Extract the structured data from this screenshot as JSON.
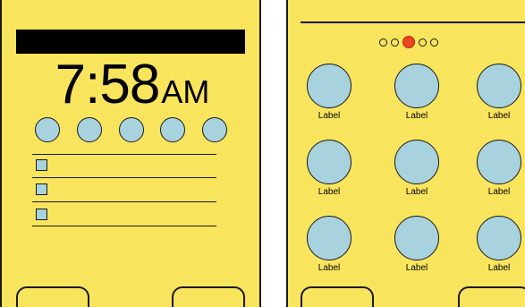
{
  "left_screen": {
    "clock": {
      "time": "7:58",
      "ampm": "AM"
    },
    "shortcut_count": 5,
    "list_item_count": 3
  },
  "right_screen": {
    "pager": {
      "pages": 5,
      "active_page": 3
    },
    "grid_labels": [
      "Label",
      "Label",
      "Label",
      "Label",
      "Label",
      "Label",
      "Label",
      "Label",
      "Label"
    ]
  },
  "colors": {
    "background": "#f9e45e",
    "circle_fill": "#a8d2de",
    "active_dot": "#ee4422",
    "stroke": "#1a1a1a"
  }
}
